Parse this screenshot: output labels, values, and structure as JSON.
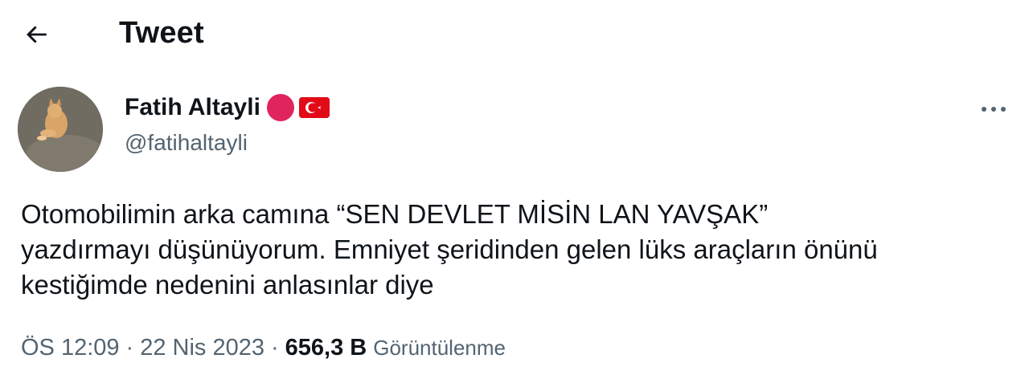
{
  "header": {
    "back_icon": "arrow-left-icon",
    "title": "Tweet"
  },
  "author": {
    "display_name": "Fatih Altayli",
    "handle": "@fatihaltayli",
    "badges": [
      "red-circle-icon",
      "turkey-flag-icon"
    ],
    "badge_colors": {
      "dot": "#e0245e",
      "flag": "#e30a17"
    }
  },
  "tweet": {
    "lines": [
      "Otomobilimin arka camına “SEN DEVLET MİSİN LAN YAVŞAK”",
      "yazdırmayı düşünüyorum. Emniyet şeridinden gelen lüks araçların önünü",
      "kestiğimde nedenini anlasınlar diye"
    ]
  },
  "meta": {
    "time": "ÖS 12:09",
    "separator": "·",
    "date": "22 Nis 2023",
    "views_count": "656,3 B",
    "views_label": "Görüntülenme"
  },
  "more_icon": "more-horizontal-icon"
}
